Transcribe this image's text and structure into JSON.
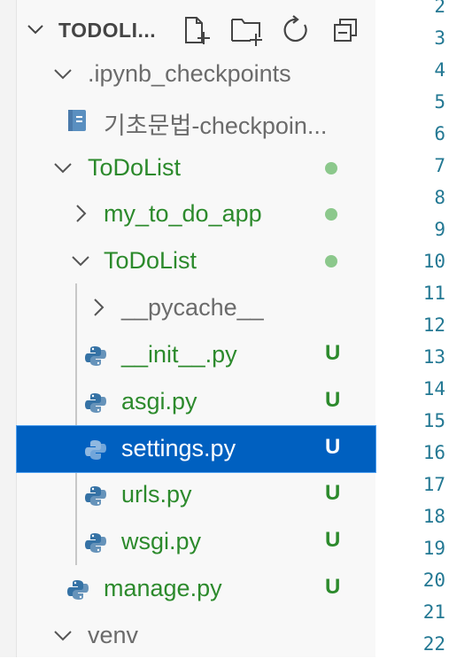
{
  "explorer": {
    "title": "TODOLI...",
    "header_icons": [
      "new-file-icon",
      "new-folder-icon",
      "refresh-icon",
      "collapse-all-icon"
    ],
    "items": [
      {
        "label": ".ipynb_checkpoints",
        "type": "folder",
        "expanded": true,
        "status": ""
      },
      {
        "label": "기초문법-checkpoin...",
        "type": "notebook",
        "status": ""
      },
      {
        "label": "ToDoList",
        "type": "folder",
        "expanded": true,
        "status": "modified-dot"
      },
      {
        "label": "my_to_do_app",
        "type": "folder",
        "expanded": false,
        "status": "modified-dot"
      },
      {
        "label": "ToDoList",
        "type": "folder",
        "expanded": true,
        "status": "modified-dot"
      },
      {
        "label": "__pycache__",
        "type": "folder",
        "expanded": false,
        "status": ""
      },
      {
        "label": "__init__.py",
        "type": "python",
        "status": "U"
      },
      {
        "label": "asgi.py",
        "type": "python",
        "status": "U"
      },
      {
        "label": "settings.py",
        "type": "python",
        "status": "U",
        "selected": true
      },
      {
        "label": "urls.py",
        "type": "python",
        "status": "U"
      },
      {
        "label": "wsgi.py",
        "type": "python",
        "status": "U"
      },
      {
        "label": "manage.py",
        "type": "python",
        "status": "U"
      },
      {
        "label": "venv",
        "type": "folder",
        "expanded": true,
        "status": ""
      }
    ]
  },
  "editor": {
    "line_numbers": [
      "2",
      "3",
      "4",
      "5",
      "6",
      "7",
      "8",
      "9",
      "10",
      "11",
      "12",
      "13",
      "14",
      "15",
      "16",
      "17",
      "18",
      "19",
      "20",
      "21",
      "22"
    ]
  },
  "colors": {
    "selection": "#0060c0",
    "untracked": "#2c8a2c",
    "line_number": "#237893"
  }
}
